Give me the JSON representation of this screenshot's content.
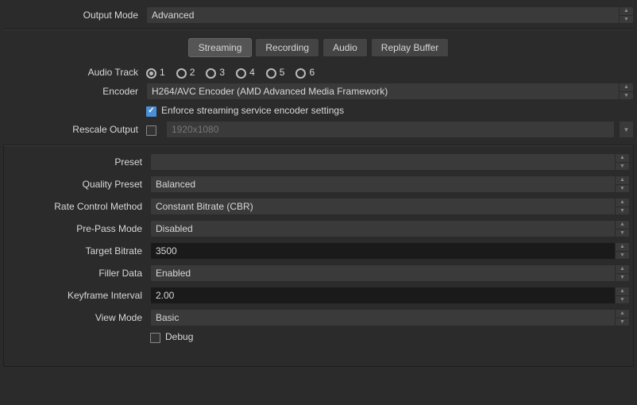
{
  "outputMode": {
    "label": "Output Mode",
    "value": "Advanced"
  },
  "tabs": [
    {
      "label": "Streaming",
      "active": true
    },
    {
      "label": "Recording",
      "active": false
    },
    {
      "label": "Audio",
      "active": false
    },
    {
      "label": "Replay Buffer",
      "active": false
    }
  ],
  "audioTrack": {
    "label": "Audio Track",
    "options": [
      "1",
      "2",
      "3",
      "4",
      "5",
      "6"
    ],
    "selected": "1"
  },
  "encoder": {
    "label": "Encoder",
    "value": "H264/AVC Encoder (AMD Advanced Media Framework)"
  },
  "enforce": {
    "label": "Enforce streaming service encoder settings",
    "checked": true
  },
  "rescale": {
    "label": "Rescale Output",
    "checked": false,
    "placeholder": "1920x1080"
  },
  "preset": {
    "label": "Preset",
    "value": ""
  },
  "qualityPreset": {
    "label": "Quality Preset",
    "value": "Balanced"
  },
  "rateControl": {
    "label": "Rate Control Method",
    "value": "Constant Bitrate (CBR)"
  },
  "prePass": {
    "label": "Pre-Pass Mode",
    "value": "Disabled"
  },
  "targetBitrate": {
    "label": "Target Bitrate",
    "value": "3500"
  },
  "fillerData": {
    "label": "Filler Data",
    "value": "Enabled"
  },
  "keyframeInterval": {
    "label": "Keyframe Interval",
    "value": "2.00"
  },
  "viewMode": {
    "label": "View Mode",
    "value": "Basic"
  },
  "debug": {
    "label": "Debug",
    "checked": false
  }
}
